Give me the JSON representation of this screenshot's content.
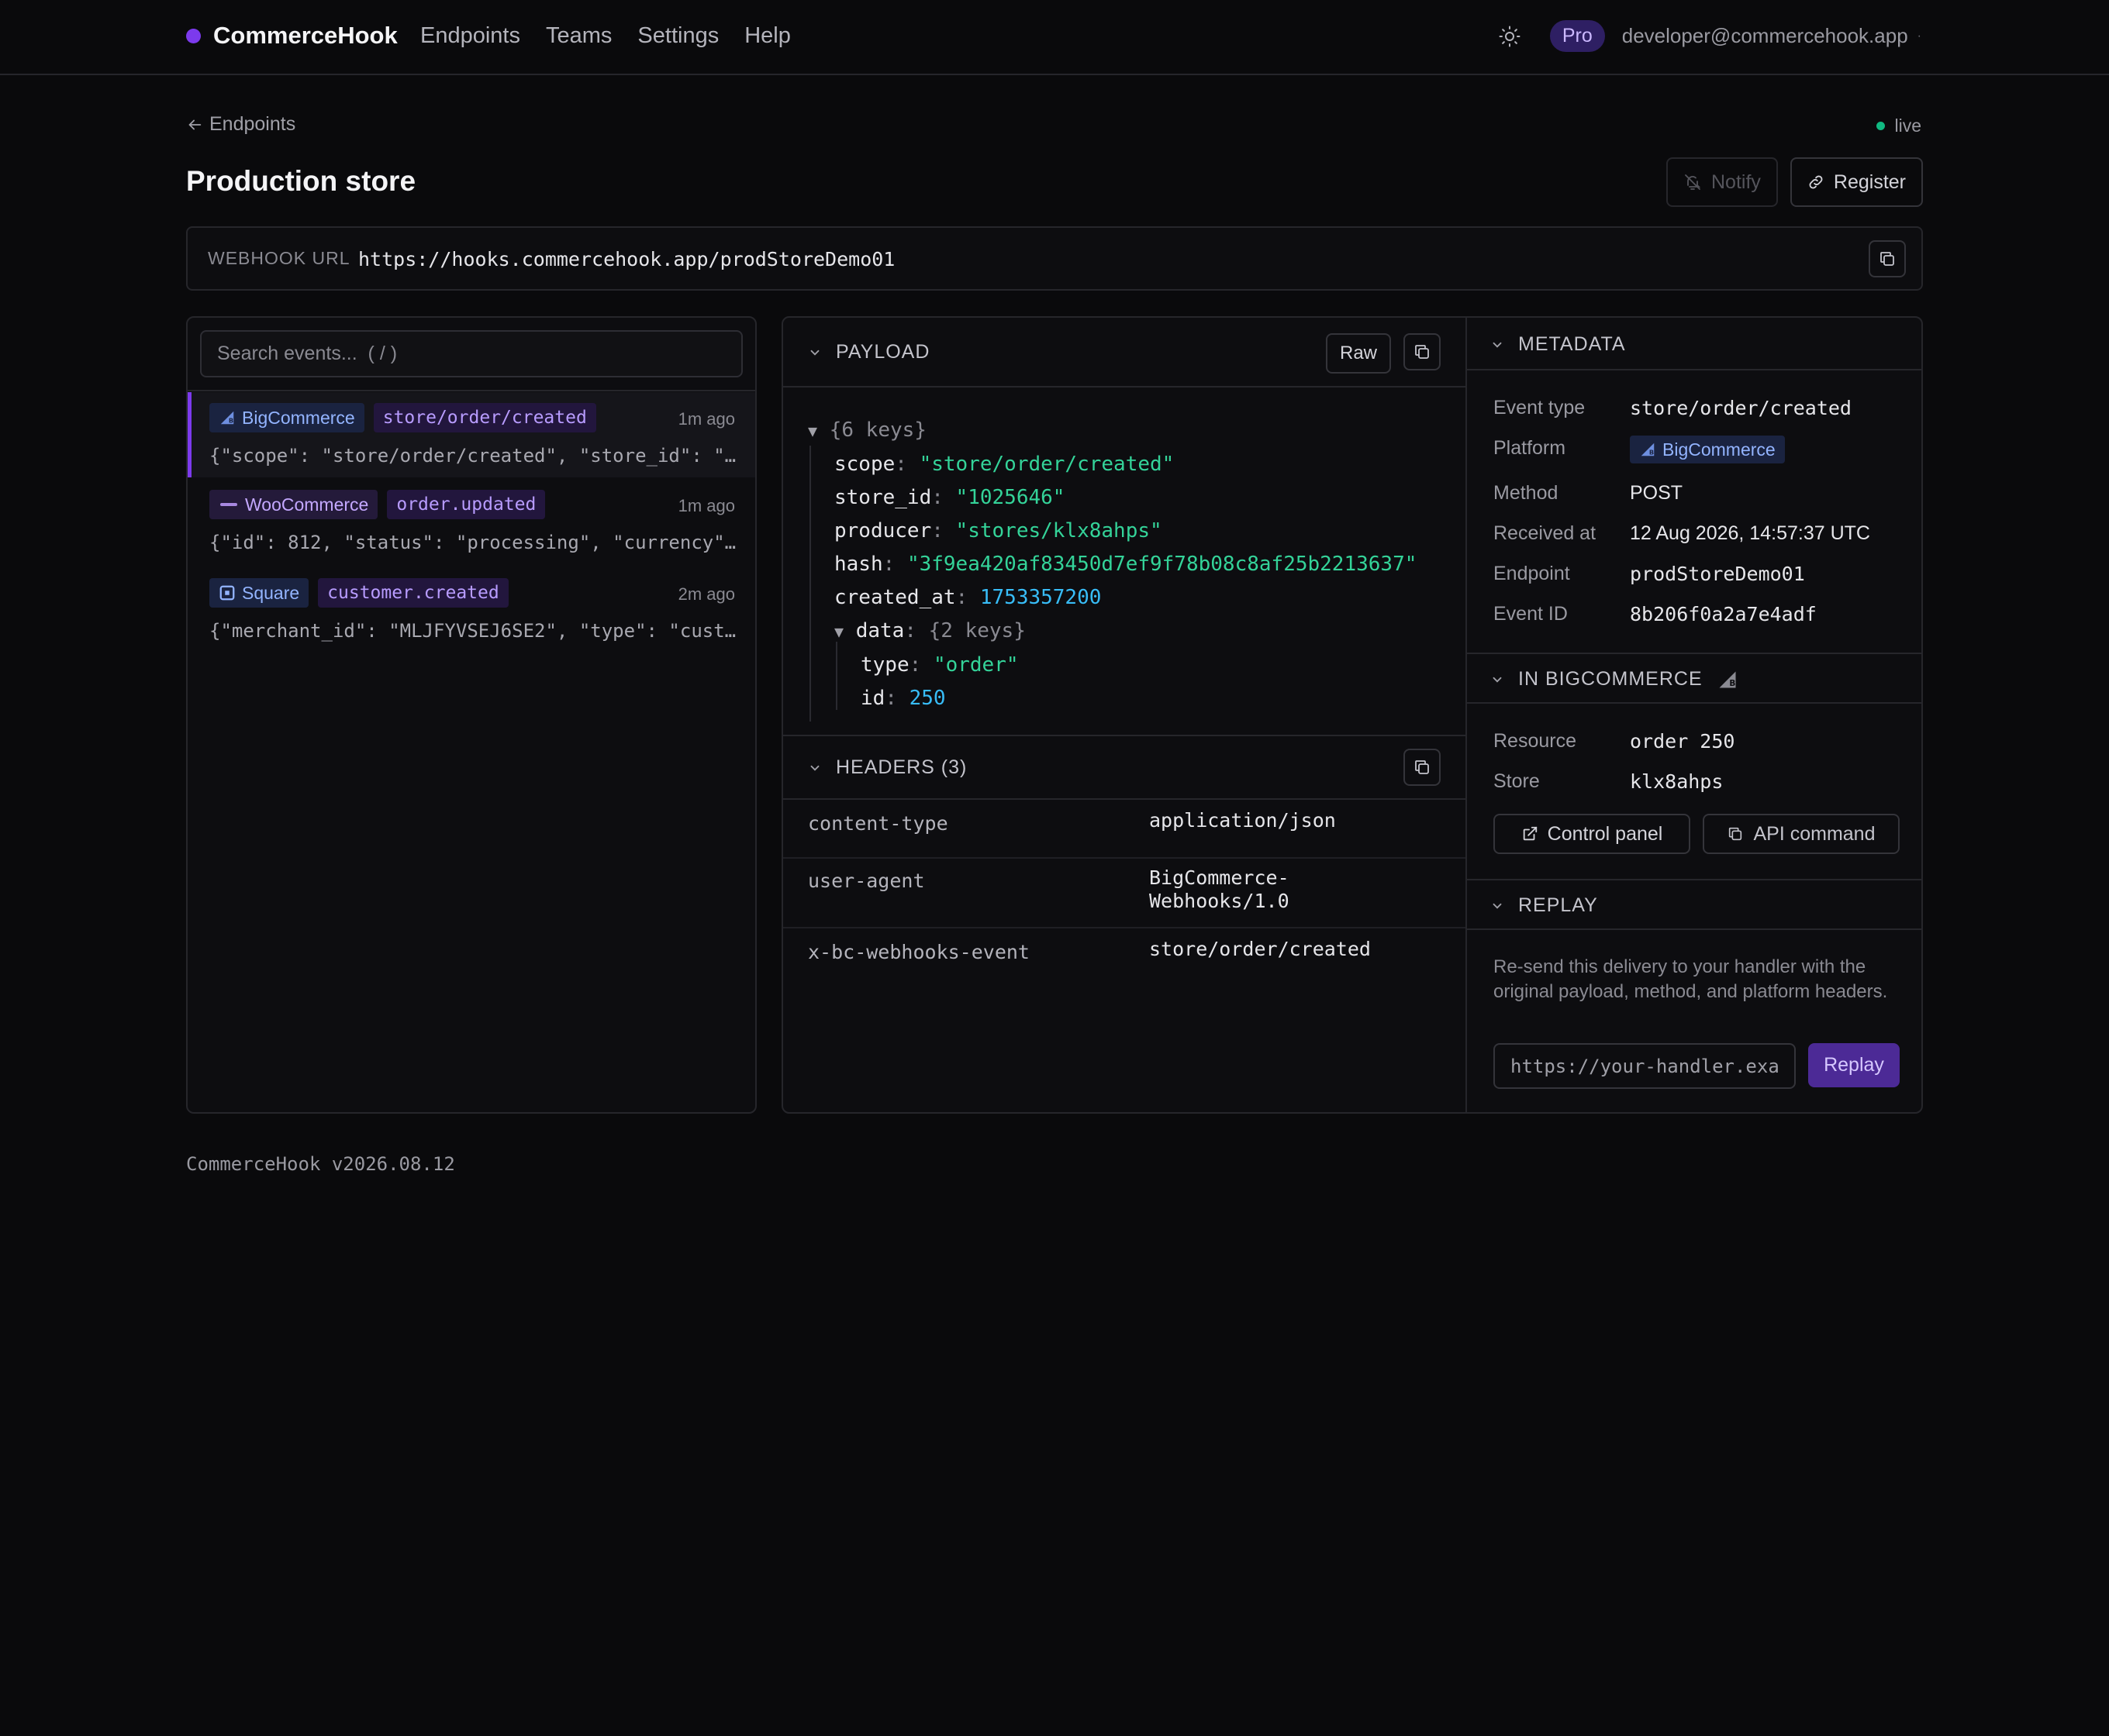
{
  "app": {
    "brand": "CommerceHook",
    "nav": [
      "Endpoints",
      "Teams",
      "Settings",
      "Help"
    ],
    "plan_badge": "Pro",
    "user_email": "developer@commercehook.app",
    "user_menu_indicator": "·"
  },
  "page": {
    "back_label": "Endpoints",
    "status": "live",
    "title": "Production store",
    "notify_label": "Notify",
    "register_label": "Register",
    "webhook_url_label": "WEBHOOK URL",
    "webhook_url": "https://hooks.commercehook.app/prodStoreDemo01"
  },
  "events": {
    "search_placeholder": "Search events...  ( / )",
    "items": [
      {
        "platform": "BigCommerce",
        "event": "store/order/created",
        "time": "1m ago",
        "preview": "{\"scope\": \"store/order/created\", \"store_id\": \"…"
      },
      {
        "platform": "WooCommerce",
        "event": "order.updated",
        "time": "1m ago",
        "preview": "{\"id\": 812, \"status\": \"processing\", \"currency\"…"
      },
      {
        "platform": "Square",
        "event": "customer.created",
        "time": "2m ago",
        "preview": "{\"merchant_id\": \"MLJFYVSEJ6SE2\", \"type\": \"cust…"
      }
    ]
  },
  "payload": {
    "title": "PAYLOAD",
    "raw_label": "Raw",
    "root_summary": "{6 keys}",
    "fields": [
      {
        "key": "scope",
        "value": "\"store/order/created\""
      },
      {
        "key": "store_id",
        "value": "\"1025646\""
      },
      {
        "key": "producer",
        "value": "\"stores/klx8ahps\""
      },
      {
        "key": "hash",
        "value": "\"3f9ea420af83450d7ef9f78b08c8af25b2213637\""
      },
      {
        "key": "created_at",
        "value": "1753357200"
      }
    ],
    "nested_key": "data",
    "nested_summary": "{2 keys}",
    "nested_fields": [
      {
        "key": "type",
        "value": "\"order\""
      },
      {
        "key": "id",
        "value": "250"
      }
    ]
  },
  "headers": {
    "title": "HEADERS (3)",
    "rows": [
      {
        "key": "content-type",
        "value": "application/json"
      },
      {
        "key": "user-agent",
        "value_line1": "BigCommerce-",
        "value_line2": "Webhooks/1.0"
      },
      {
        "key": "x-bc-webhooks-event",
        "value": "store/order/created"
      }
    ]
  },
  "metadata": {
    "title": "METADATA",
    "event_type_label": "Event type",
    "event_type": "store/order/created",
    "platform_label": "Platform",
    "platform": "BigCommerce",
    "method_label": "Method",
    "method": "POST",
    "received_label": "Received at",
    "received": "12 Aug 2026, 14:57:37 UTC",
    "endpoint_label": "Endpoint",
    "endpoint": "prodStoreDemo01",
    "event_id_label": "Event ID",
    "event_id": "8b206f0a2a7e4adf"
  },
  "in_platform": {
    "title": "IN BIGCOMMERCE",
    "resource_label": "Resource",
    "resource": "order 250",
    "store_label": "Store",
    "store": "klx8ahps",
    "control_panel_label": "Control panel",
    "api_command_label": "API command"
  },
  "replay": {
    "title": "REPLAY",
    "description": "Re-send this delivery to your handler with the original payload, method, and platform headers.",
    "input_placeholder": "https://your-handler.example.com",
    "button_label": "Replay"
  },
  "footer": {
    "version": "CommerceHook v2026.08.12"
  },
  "colors": {
    "accent": "#7c3aed",
    "live": "#10b981",
    "string": "#34d399",
    "number": "#38bdf8"
  }
}
